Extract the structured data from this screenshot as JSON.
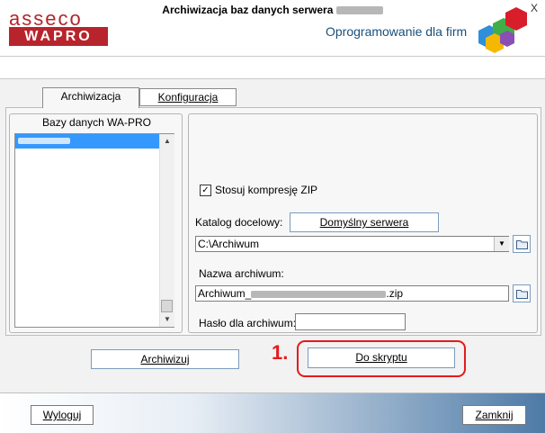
{
  "header": {
    "brand_top": "asseco",
    "brand_bottom": "WAPRO",
    "tagline": "Oprogramowanie dla firm",
    "close_glyph": "X"
  },
  "window": {
    "title_prefix": "Archiwizacja baz danych serwera"
  },
  "tabs": [
    {
      "label": "Archiwizacja",
      "active": true
    },
    {
      "label": "Konfiguracja",
      "active": false,
      "mnemonic": "K"
    }
  ],
  "databases": {
    "group_title": "Bazy danych WA-PRO",
    "scroll_up": "▲",
    "scroll_down": "▼"
  },
  "options": {
    "zip_checkbox_label": "Stosuj kompresję ZIP",
    "zip_checked": true,
    "check_glyph": "✓",
    "target_dir_label": "Katalog docelowy:",
    "default_server_button": "Domyślny serwera",
    "target_dir_value": "C:\\Archiwum",
    "dropdown_glyph": "▼",
    "archive_name_label": "Nazwa archiwum:",
    "archive_name_prefix": "Archiwum_",
    "archive_name_suffix": ".zip",
    "password_label": "Hasło dla archiwum:",
    "password_value": ""
  },
  "actions": {
    "archive_button": "Archiwizuj",
    "script_button": "Do skryptu",
    "step_marker": "1."
  },
  "footer": {
    "logout_button": "Wyloguj",
    "close_button": "Zamknij"
  },
  "colors": {
    "brand_red": "#b8242c",
    "highlight_red": "#e41b1b",
    "selection_blue": "#3399ff",
    "tagline_blue": "#1a4f7a"
  }
}
